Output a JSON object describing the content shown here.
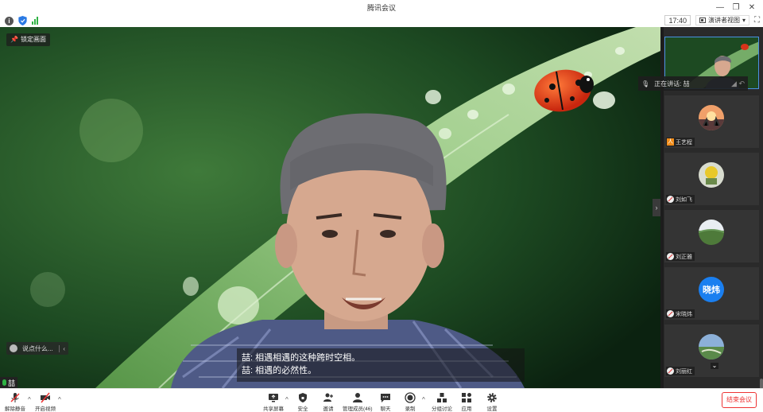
{
  "window": {
    "title": "腾讯会议"
  },
  "status": {
    "time": "17:40",
    "view_label": "演讲者视图"
  },
  "stage": {
    "fixed_label": "锁定画面",
    "chat_placeholder": "说点什么...",
    "subtitles": [
      "喆: 相遇相遇的这种跨时空相。",
      "喆: 相遇的必然性。"
    ],
    "speaker_badge": "喆"
  },
  "sidebar": {
    "speaking_label": "正在讲话: 喆",
    "participants": [
      {
        "name": "王艺程",
        "role": "host"
      },
      {
        "name": "刘如飞",
        "role": "muted"
      },
      {
        "name": "刘正雅",
        "role": "muted"
      },
      {
        "name": "宋晓炜",
        "role": "muted",
        "avatar_text": "晓炜",
        "avatar_color": "#1a7ff0"
      },
      {
        "name": "刘丽红",
        "role": "muted"
      }
    ]
  },
  "toolbar": {
    "unmute": "解除静音",
    "start_video": "开启视频",
    "share": "共享屏幕",
    "security": "安全",
    "invite": "邀请",
    "manage": "管理成员(46)",
    "chat": "聊天",
    "record": "录制",
    "breakout": "分组讨论",
    "apps": "应用",
    "settings": "设置",
    "end": "结束会议"
  },
  "colors": {
    "accent": "#1a7ff0",
    "danger": "#e33333",
    "signal": "#2fb344"
  }
}
